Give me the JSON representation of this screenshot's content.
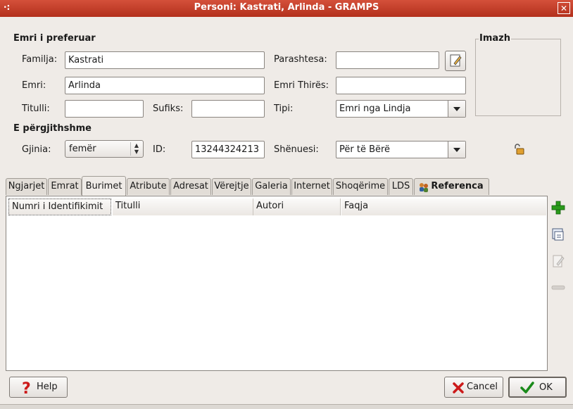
{
  "window": {
    "title": "Personi: Kastrati, Arlinda - GRAMPS",
    "menu_glyph": "·:",
    "close_glyph": "✕"
  },
  "preferred_name": {
    "section_title": "Emri i preferuar",
    "family_label": "Familja:",
    "family_value": "Kastrati",
    "prefix_label": "Parashtesa:",
    "prefix_value": "",
    "given_label": "Emri:",
    "given_value": "Arlinda",
    "call_label": "Emri Thirës:",
    "call_value": "",
    "title_label": "Titulli:",
    "title_value": "",
    "suffix_label": "Sufiks:",
    "suffix_value": "",
    "type_label": "Tipi:",
    "type_value": "Emri nga Lindja"
  },
  "general": {
    "section_title": "E përgjithshme",
    "gender_label": "Gjinia:",
    "gender_value": "femër",
    "id_label": "ID:",
    "id_value": "13244324213",
    "marker_label": "Shënuesi:",
    "marker_value": "Për të Bërë"
  },
  "image": {
    "frame_label": "Imazh"
  },
  "tabs": [
    {
      "label": "Ngjarjet"
    },
    {
      "label": "Emrat"
    },
    {
      "label": "Burimet"
    },
    {
      "label": "Atribute"
    },
    {
      "label": "Adresat"
    },
    {
      "label": "Vërejtje"
    },
    {
      "label": "Galeria"
    },
    {
      "label": "Internet"
    },
    {
      "label": "Shoqërime"
    },
    {
      "label": "LDS"
    },
    {
      "label": "Referenca"
    }
  ],
  "active_tab": "Burimet",
  "sources_table": {
    "columns": [
      "Numri i Identifikimit",
      "Titulli",
      "Autori",
      "Faqja"
    ],
    "rows": []
  },
  "buttons": {
    "help": "Help",
    "cancel": "Cancel",
    "ok": "OK"
  },
  "colors": {
    "titlebar": "#c0402a",
    "add": "#2a9a1a",
    "cancel_x": "#cc1a1a",
    "ok_check": "#1a8a1a"
  }
}
